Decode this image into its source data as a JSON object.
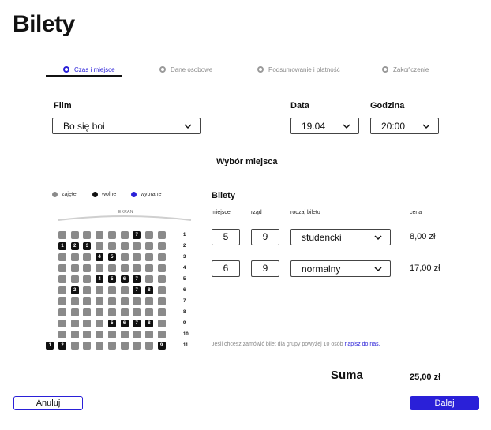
{
  "page_title": "Bilety",
  "steps": [
    {
      "label": "Czas i miejsce",
      "active": true
    },
    {
      "label": "Dane osobowe",
      "active": false
    },
    {
      "label": "Podsumowanie i płatność",
      "active": false
    },
    {
      "label": "Zakończenie",
      "active": false
    }
  ],
  "film": {
    "label": "Film",
    "value": "Bo się boi"
  },
  "date": {
    "label": "Data",
    "value": "19.04"
  },
  "time": {
    "label": "Godzina",
    "value": "20:00"
  },
  "seat_section_title": "Wybór miejsca",
  "legend": [
    {
      "label": "zajęte",
      "color": "#8a8a8a"
    },
    {
      "label": "wolne",
      "color": "#111111"
    },
    {
      "label": "wybrane",
      "color": "#2a20d8"
    }
  ],
  "screen_label": "EKRAN",
  "seat_rows": [
    {
      "row": "1",
      "seats": [
        {
          "n": "",
          "free": false
        },
        {
          "n": "",
          "free": false
        },
        {
          "n": "",
          "free": false
        },
        {
          "n": "",
          "free": false
        },
        {
          "n": "",
          "free": false
        },
        {
          "n": "",
          "free": false
        },
        {
          "n": "7",
          "free": true
        },
        {
          "n": "",
          "free": false
        },
        {
          "n": "",
          "free": false
        }
      ]
    },
    {
      "row": "2",
      "seats": [
        {
          "n": "1",
          "free": true
        },
        {
          "n": "2",
          "free": true
        },
        {
          "n": "3",
          "free": true
        },
        {
          "n": "",
          "free": false
        },
        {
          "n": "",
          "free": false
        },
        {
          "n": "",
          "free": false
        },
        {
          "n": "",
          "free": false
        },
        {
          "n": "",
          "free": false
        },
        {
          "n": "",
          "free": false
        }
      ]
    },
    {
      "row": "3",
      "seats": [
        {
          "n": "",
          "free": false
        },
        {
          "n": "",
          "free": false
        },
        {
          "n": "",
          "free": false
        },
        {
          "n": "4",
          "free": true
        },
        {
          "n": "5",
          "free": true
        },
        {
          "n": "",
          "free": false
        },
        {
          "n": "",
          "free": false
        },
        {
          "n": "",
          "free": false
        },
        {
          "n": "",
          "free": false
        }
      ]
    },
    {
      "row": "4",
      "seats": [
        {
          "n": "",
          "free": false
        },
        {
          "n": "",
          "free": false
        },
        {
          "n": "",
          "free": false
        },
        {
          "n": "",
          "free": false
        },
        {
          "n": "",
          "free": false
        },
        {
          "n": "",
          "free": false
        },
        {
          "n": "",
          "free": false
        },
        {
          "n": "",
          "free": false
        },
        {
          "n": "",
          "free": false
        }
      ]
    },
    {
      "row": "5",
      "seats": [
        {
          "n": "",
          "free": false
        },
        {
          "n": "",
          "free": false
        },
        {
          "n": "",
          "free": false
        },
        {
          "n": "4",
          "free": true
        },
        {
          "n": "5",
          "free": true
        },
        {
          "n": "6",
          "free": true
        },
        {
          "n": "7",
          "free": true
        },
        {
          "n": "",
          "free": false
        },
        {
          "n": "",
          "free": false
        }
      ]
    },
    {
      "row": "6",
      "seats": [
        {
          "n": "",
          "free": false
        },
        {
          "n": "2",
          "free": true
        },
        {
          "n": "",
          "free": false
        },
        {
          "n": "",
          "free": false
        },
        {
          "n": "",
          "free": false
        },
        {
          "n": "",
          "free": false
        },
        {
          "n": "7",
          "free": true
        },
        {
          "n": "8",
          "free": true
        },
        {
          "n": "",
          "free": false
        }
      ]
    },
    {
      "row": "7",
      "seats": [
        {
          "n": "",
          "free": false
        },
        {
          "n": "",
          "free": false
        },
        {
          "n": "",
          "free": false
        },
        {
          "n": "",
          "free": false
        },
        {
          "n": "",
          "free": false
        },
        {
          "n": "",
          "free": false
        },
        {
          "n": "",
          "free": false
        },
        {
          "n": "",
          "free": false
        },
        {
          "n": "",
          "free": false
        }
      ]
    },
    {
      "row": "8",
      "seats": [
        {
          "n": "",
          "free": false
        },
        {
          "n": "",
          "free": false
        },
        {
          "n": "",
          "free": false
        },
        {
          "n": "",
          "free": false
        },
        {
          "n": "",
          "free": false
        },
        {
          "n": "",
          "free": false
        },
        {
          "n": "",
          "free": false
        },
        {
          "n": "",
          "free": false
        },
        {
          "n": "",
          "free": false
        }
      ]
    },
    {
      "row": "9",
      "seats": [
        {
          "n": "",
          "free": false
        },
        {
          "n": "",
          "free": false
        },
        {
          "n": "",
          "free": false
        },
        {
          "n": "",
          "free": false
        },
        {
          "n": "5",
          "free": true
        },
        {
          "n": "6",
          "free": true
        },
        {
          "n": "7",
          "free": true
        },
        {
          "n": "8",
          "free": true
        },
        {
          "n": "",
          "free": false
        }
      ]
    },
    {
      "row": "10",
      "seats": [
        {
          "n": "",
          "free": false
        },
        {
          "n": "",
          "free": false
        },
        {
          "n": "",
          "free": false
        },
        {
          "n": "",
          "free": false
        },
        {
          "n": "",
          "free": false
        },
        {
          "n": "",
          "free": false
        },
        {
          "n": "",
          "free": false
        },
        {
          "n": "",
          "free": false
        },
        {
          "n": "",
          "free": false
        }
      ]
    },
    {
      "row": "11",
      "seats": [
        {
          "n": "1",
          "free": true
        },
        {
          "n": "2",
          "free": true
        },
        {
          "n": "",
          "free": false
        },
        {
          "n": "",
          "free": false
        },
        {
          "n": "",
          "free": false
        },
        {
          "n": "",
          "free": false
        },
        {
          "n": "",
          "free": false
        },
        {
          "n": "",
          "free": false
        },
        {
          "n": "",
          "free": false
        },
        {
          "n": "9",
          "free": true
        }
      ]
    }
  ],
  "tickets": {
    "title": "Bilety",
    "headers": {
      "seat": "miejsce",
      "row": "rząd",
      "type": "rodzaj biletu",
      "price": "cena"
    },
    "items": [
      {
        "seat": "5",
        "row": "9",
        "type": "studencki",
        "price": "8,00 zł"
      },
      {
        "seat": "6",
        "row": "9",
        "type": "normalny",
        "price": "17,00 zł"
      }
    ]
  },
  "group_note": {
    "text": "Jeśli chcesz zamówić bilet dla grupy powyżej 10 osób ",
    "link": "napisz do nas."
  },
  "sum": {
    "label": "Suma",
    "value": "25,00 zł"
  },
  "buttons": {
    "cancel": "Anuluj",
    "next": "Dalej"
  }
}
